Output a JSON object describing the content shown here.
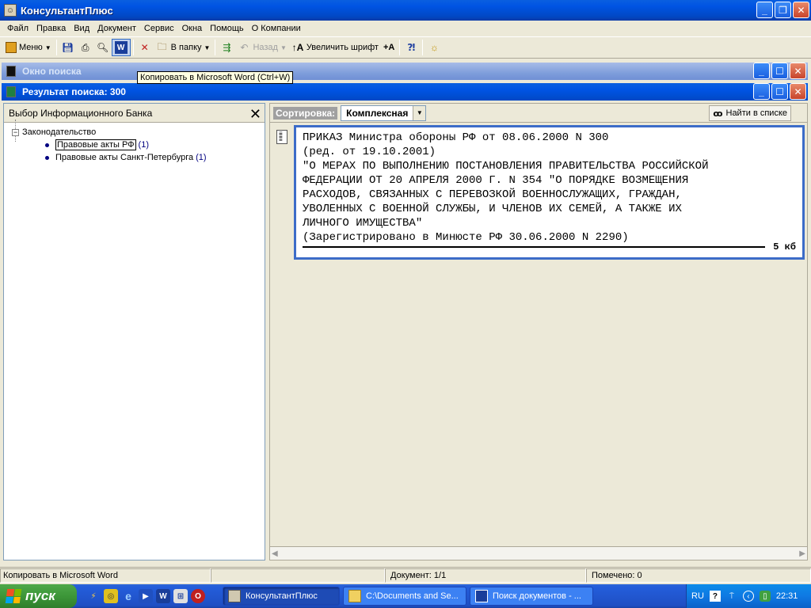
{
  "app": {
    "title": "КонсультантПлюс"
  },
  "menu": [
    "Файл",
    "Правка",
    "Вид",
    "Документ",
    "Сервис",
    "Окна",
    "Помощь",
    "О Компании"
  ],
  "toolbar": {
    "menu_label": "Меню",
    "to_folder_label": "В папку",
    "back_label": "Назад",
    "increase_font_label": "Увеличить шрифт",
    "increase_font_small": "+A"
  },
  "tooltip": "Копировать в Microsoft Word (Ctrl+W)",
  "search_window": {
    "title": "Окно поиска"
  },
  "results_window": {
    "title": "Результат поиска: 300"
  },
  "left_panel": {
    "title": "Выбор Информационного Банка",
    "root": "Законодательство",
    "items": [
      {
        "label": "Правовые акты РФ",
        "count": "(1)"
      },
      {
        "label": "Правовые акты Санкт-Петербурга",
        "count": "(1)"
      }
    ]
  },
  "right_panel": {
    "sort_label": "Сортировка:",
    "sort_value": "Комплексная",
    "find_label": "Найти в списке",
    "document": {
      "lines": [
        "ПРИКАЗ Министра обороны РФ от 08.06.2000 N 300",
        "(ред. от 19.10.2001)",
        "\"О МЕРАХ ПО ВЫПОЛНЕНИЮ ПОСТАНОВЛЕНИЯ ПРАВИТЕЛЬСТВА РОССИЙСКОЙ",
        "ФЕДЕРАЦИИ ОТ 20 АПРЕЛЯ 2000 Г. N 354 \"О ПОРЯДКЕ ВОЗМЕЩЕНИЯ",
        "РАСХОДОВ, СВЯЗАННЫХ С ПЕРЕВОЗКОЙ ВОЕННОСЛУЖАЩИХ, ГРАЖДАН,",
        "УВОЛЕННЫХ С ВОЕННОЙ СЛУЖБЫ, И ЧЛЕНОВ ИХ СЕМЕЙ, А ТАКЖЕ ИХ",
        "ЛИЧНОГО ИМУЩЕСТВА\"",
        "(Зарегистрировано в Минюсте РФ 30.06.2000 N 2290)"
      ],
      "size": "5 кб"
    }
  },
  "status": {
    "hint": "Копировать в Microsoft Word",
    "document": "Документ: 1/1",
    "marked": "Помечено: 0"
  },
  "taskbar": {
    "start_label": "пуск",
    "tasks": [
      {
        "label": "КонсультантПлюс",
        "active": true
      },
      {
        "label": "C:\\Documents and Se...",
        "active": false
      },
      {
        "label": "Поиск документов - ...",
        "active": false
      }
    ],
    "language": "RU",
    "clock": "22:31"
  },
  "colors": {
    "accent": "#0054e3",
    "card_border": "#3c6cc8",
    "start_green": "#3c9638"
  }
}
